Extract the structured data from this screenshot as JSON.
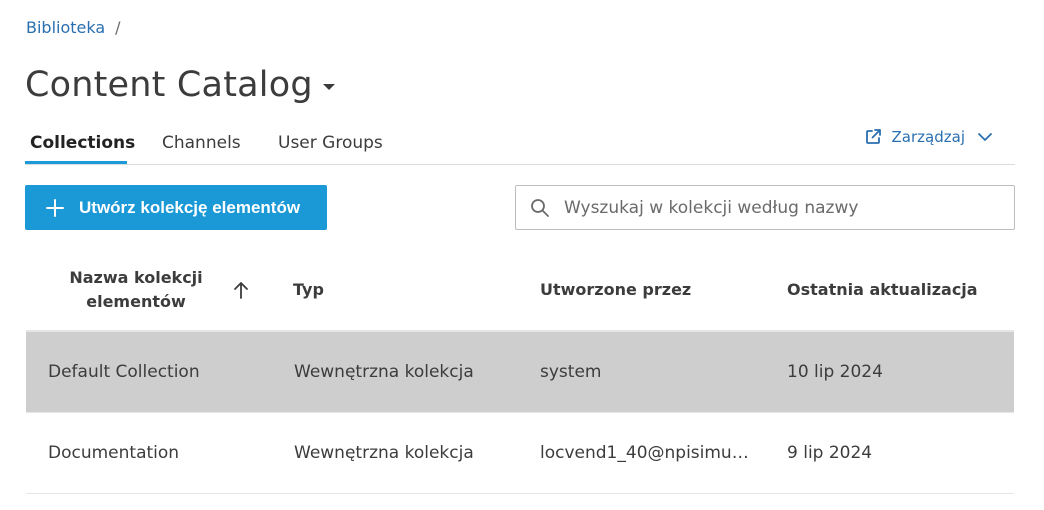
{
  "breadcrumb": {
    "root": "Biblioteka",
    "separator": "/"
  },
  "header": {
    "title": "Content Catalog"
  },
  "tabs": [
    {
      "label": "Collections",
      "active": true
    },
    {
      "label": "Channels",
      "active": false
    },
    {
      "label": "User Groups",
      "active": false
    }
  ],
  "manage": {
    "label": "Zarządzaj"
  },
  "toolbar": {
    "create_label": "Utwórz kolekcję elementów",
    "search_placeholder": "Wyszukaj w kolekcji według nazwy"
  },
  "table": {
    "columns": {
      "name": "Nazwa kolekcji elementów",
      "type": "Typ",
      "created_by": "Utworzone przez",
      "updated": "Ostatnia aktualizacja"
    },
    "rows": [
      {
        "name": "Default Collection",
        "type": "Wewnętrzna kolekcja",
        "created_by": "system",
        "updated": "10 lip 2024"
      },
      {
        "name": "Documentation",
        "type": "Wewnętrzna kolekcja",
        "created_by": "locvend1_40@npisimul...",
        "updated": "9 lip 2024"
      }
    ]
  },
  "colors": {
    "accent": "#1b98d6",
    "link": "#2a6fb0",
    "selected_row": "#cecece"
  },
  "icons": {
    "title_dropdown": "caret-down-icon",
    "manage": "external-link-icon",
    "manage_expand": "chevron-down-icon",
    "create": "plus-icon",
    "search": "search-icon",
    "sort": "arrow-up-icon"
  }
}
